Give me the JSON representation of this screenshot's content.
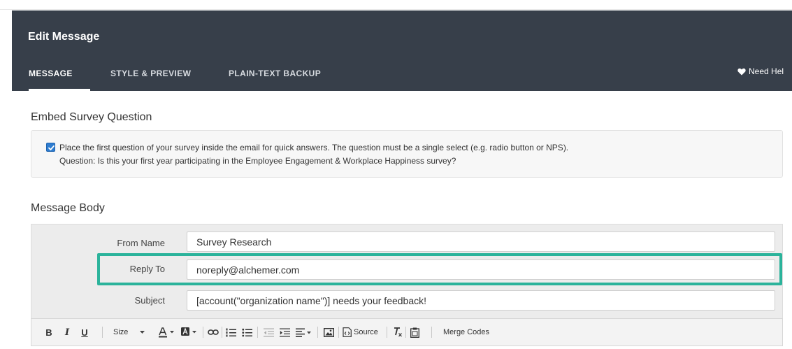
{
  "header": {
    "title": "Edit Message",
    "tabs": [
      {
        "label": "MESSAGE",
        "active": true
      },
      {
        "label": "STYLE & PREVIEW",
        "active": false
      },
      {
        "label": "PLAIN-TEXT BACKUP",
        "active": false
      }
    ],
    "help_label": "Need Hel",
    "help_icon": "heart-icon"
  },
  "embed": {
    "title": "Embed Survey Question",
    "checked": true,
    "line1": "Place the first question of your survey inside the email for quick answers. The question must be a single select (e.g. radio button or NPS).",
    "line2": "Question: Is this your first year participating in the Employee Engagement & Workplace Happiness survey?"
  },
  "message_body": {
    "title": "Message Body",
    "fields": {
      "from_name": {
        "label": "From Name",
        "value": "Survey Research"
      },
      "reply_to": {
        "label": "Reply To",
        "value": "noreply@alchemer.com"
      },
      "subject": {
        "label": "Subject",
        "value": "[account(\"organization name\")] needs your feedback!"
      }
    }
  },
  "toolbar": {
    "bold": "B",
    "italic": "I",
    "underline": "U",
    "size_label": "Size",
    "source_label": "Source",
    "merge_codes_label": "Merge Codes"
  },
  "colors": {
    "header_bg": "#373f4a",
    "highlight": "#2bb39b",
    "checkbox": "#2f7dd0"
  }
}
